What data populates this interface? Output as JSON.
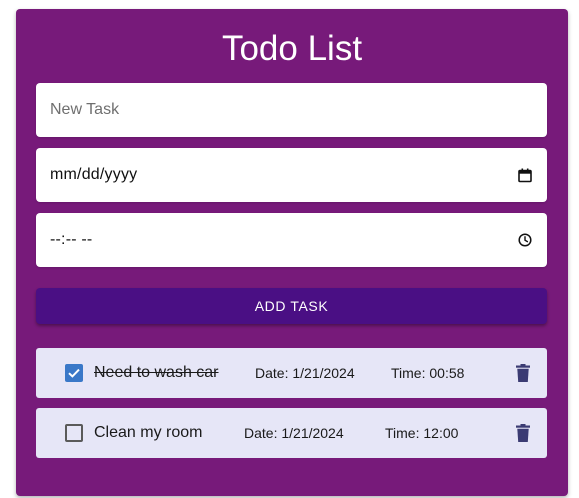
{
  "app": {
    "title": "Todo List"
  },
  "form": {
    "task_placeholder": "New Task",
    "date_placeholder": "mm/dd/yyyy",
    "time_placeholder": "--:-- --",
    "add_button_label": "ADD TASK"
  },
  "tasks": [
    {
      "name": "Need to wash car",
      "date": "Date: 1/21/2024",
      "time": "Time: 00:58",
      "completed": true
    },
    {
      "name": "Clean my room",
      "date": "Date: 1/21/2024",
      "time": "Time: 12:00",
      "completed": false
    }
  ],
  "colors": {
    "card_background": "#771a7a",
    "button_background": "#4a0f84",
    "task_background": "#e6e6f7",
    "checkbox_checked": "#3a78c8",
    "trash_icon": "#3b3b73"
  },
  "icons": {
    "date": "calendar-icon",
    "time": "clock-icon",
    "delete": "trash-icon",
    "checked": "checkbox-checked-icon",
    "unchecked": "checkbox-unchecked-icon"
  }
}
